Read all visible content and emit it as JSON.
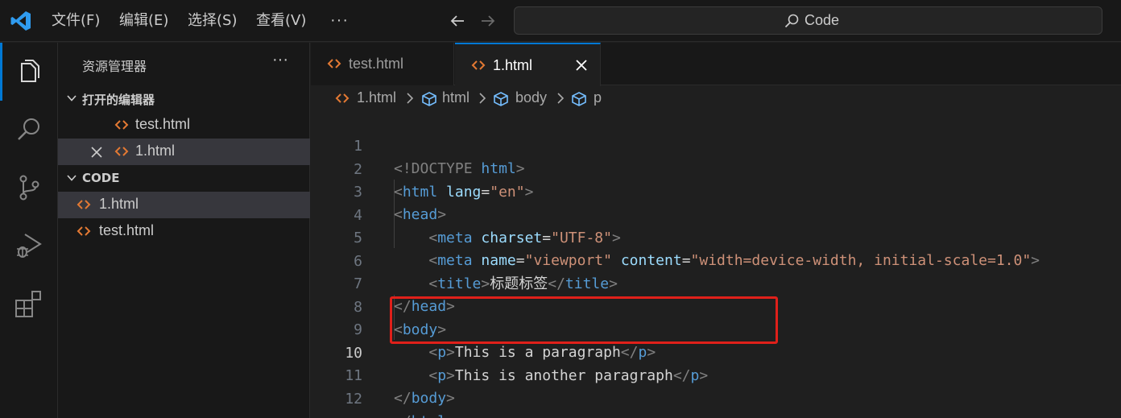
{
  "titlebar": {
    "menus": [
      "文件(F)",
      "编辑(E)",
      "选择(S)",
      "查看(V)"
    ],
    "more": "···",
    "search_text": "Code"
  },
  "activity_bar": {
    "items": [
      "explorer-icon",
      "search-icon",
      "source-control-icon",
      "run-debug-icon",
      "extensions-icon"
    ],
    "active": "explorer-icon",
    "accent": "#0078d4"
  },
  "sidebar": {
    "title": "资源管理器",
    "more": "···",
    "open_editors": {
      "label": "打开的编辑器",
      "items": [
        {
          "name": "test.html"
        },
        {
          "name": "1.html"
        }
      ]
    },
    "workspace": {
      "label": "CODE",
      "items": [
        {
          "name": "1.html"
        },
        {
          "name": "test.html"
        }
      ]
    }
  },
  "tabs": [
    {
      "name": "test.html",
      "active": false
    },
    {
      "name": "1.html",
      "active": true
    }
  ],
  "breadcrumb": [
    "1.html",
    "html",
    "body",
    "p"
  ],
  "editor": {
    "current_line": "10",
    "highlight_color": "#e0201a",
    "line_numbers": [
      "1",
      "2",
      "3",
      "4",
      "5",
      "6",
      "7",
      "8",
      "9",
      "10",
      "11",
      "12"
    ],
    "tokens": {
      "doctype": "<!DOCTYPE",
      "doctype_html": "html",
      "lt": "<",
      "gt": ">",
      "close_lt": "</",
      "eq": "=",
      "tag_html": "html",
      "tag_head": "head",
      "tag_meta": "meta",
      "tag_title": "title",
      "tag_body": "body",
      "tag_p": "p",
      "attr_lang": "lang",
      "val_lang": "\"en\"",
      "attr_charset": "charset",
      "val_charset": "\"UTF-8\"",
      "attr_name": "name",
      "val_name": "\"viewport\"",
      "attr_content": "content",
      "val_content": "\"width=device-width, initial-scale=1.0\"",
      "title_text": "标题标签",
      "p1_text": "This is a paragraph",
      "p2_text": "This is another paragraph"
    }
  }
}
